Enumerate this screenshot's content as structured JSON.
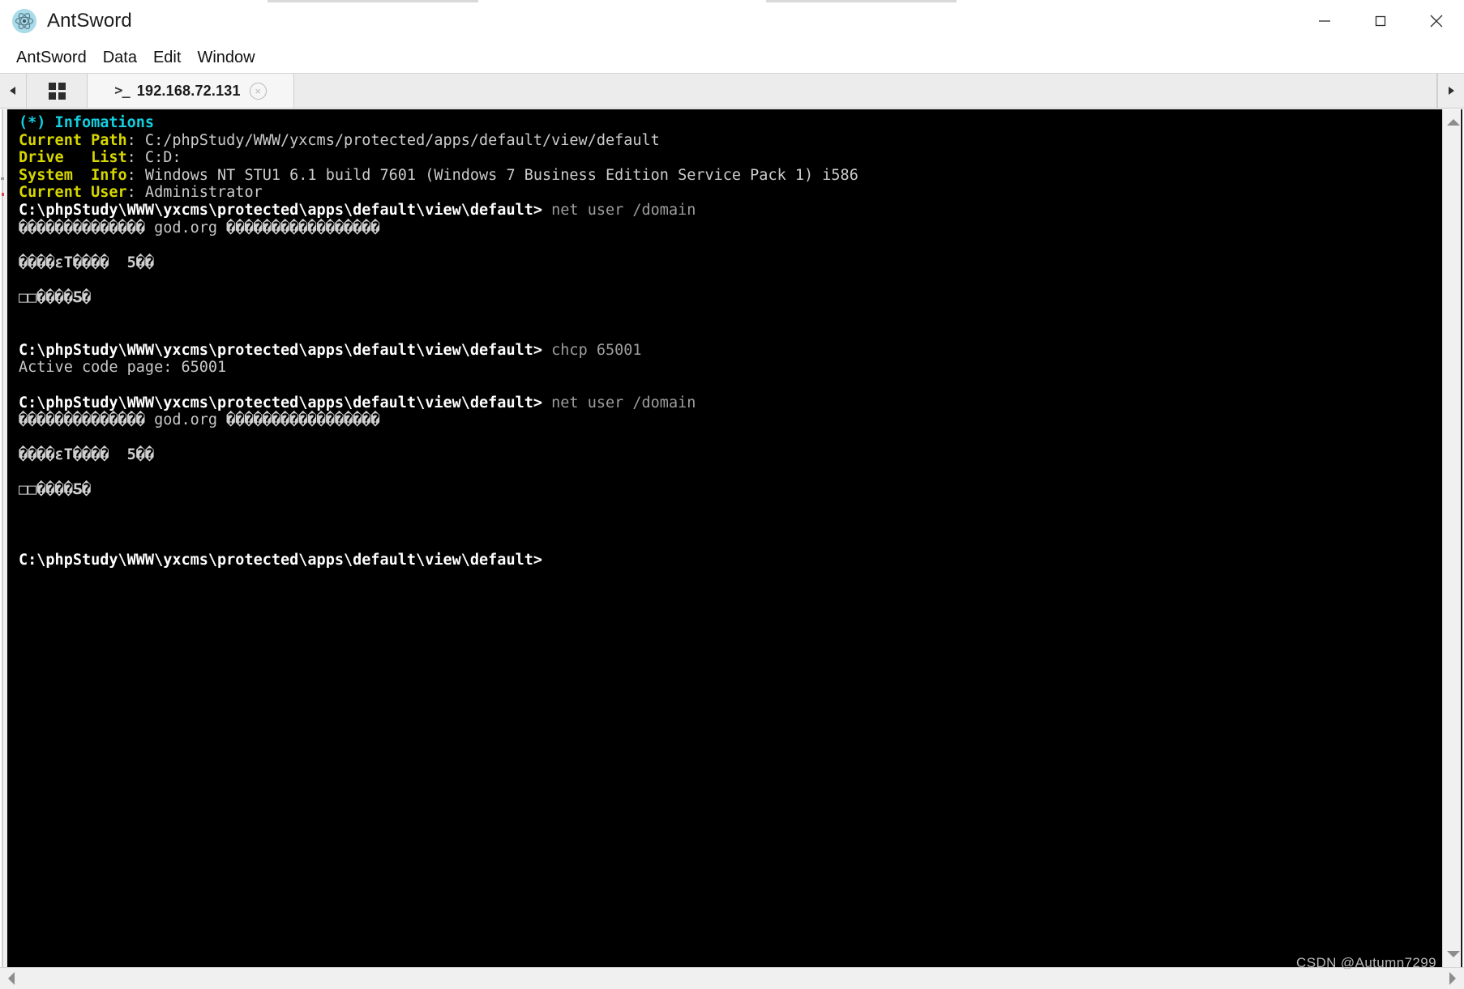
{
  "window": {
    "title": "AntSword",
    "logo_icon": "electron-atom-icon",
    "controls": {
      "minimize": "minimize-icon",
      "maximize": "maximize-icon",
      "close": "close-icon"
    }
  },
  "menubar": {
    "items": [
      {
        "label": "AntSword"
      },
      {
        "label": "Data"
      },
      {
        "label": "Edit"
      },
      {
        "label": "Window"
      }
    ]
  },
  "tabbar": {
    "scroll_left_icon": "chevron-left-icon",
    "scroll_right_icon": "chevron-right-icon",
    "grid_icon": "grid-view-icon",
    "tabs": [
      {
        "icon": "terminal-prompt-icon",
        "icon_glyph": ">_",
        "label": "192.168.72.131",
        "close_icon": "close-circle-icon",
        "close_glyph": "×",
        "active": true
      }
    ]
  },
  "terminal": {
    "colors": {
      "background": "#000000",
      "header_cyan": "#12cfe0",
      "label_yellow": "#d6d600",
      "value_gray": "#cccccc",
      "prompt_white": "#ffffff",
      "command_gray": "#9d9d9d"
    },
    "header": "(*) Infomations",
    "info": [
      {
        "label": "Current Path",
        "value": "C:/phpStudy/WWW/yxcms/protected/apps/default/view/default"
      },
      {
        "label": "Drive   List",
        "value": "C:D:"
      },
      {
        "label": "System  Info",
        "value": "Windows NT STU1 6.1 build 7601 (Windows 7 Business Edition Service Pack 1) i586"
      },
      {
        "label": "Current User",
        "value": "Administrator"
      }
    ],
    "prompt": "C:\\phpStudy\\WWW\\yxcms\\protected\\apps\\default\\view\\default>",
    "blocks": [
      {
        "command": " net user /domain",
        "output": [
          "�������������� god.org �����������������",
          "",
          "����εT����  5��",
          "",
          "□□����Ƽ�",
          "",
          ""
        ]
      },
      {
        "command": " chcp 65001",
        "output": [
          "Active code page: 65001",
          ""
        ]
      },
      {
        "command": " net user /domain",
        "output": [
          "�������������� god.org �����������������",
          "",
          "����εT����  5��",
          "",
          "□□����Ƽ�",
          "",
          "",
          ""
        ]
      }
    ],
    "final_prompt": "C:\\phpStudy\\WWW\\yxcms\\protected\\apps\\default\\view\\default>"
  },
  "scrollbars": {
    "vertical": {
      "up_icon": "arrow-up-icon",
      "down_icon": "arrow-down-icon"
    },
    "horizontal": {
      "left_icon": "arrow-left-icon",
      "right_icon": "arrow-right-icon"
    }
  },
  "watermark": "CSDN @Autumn7299"
}
